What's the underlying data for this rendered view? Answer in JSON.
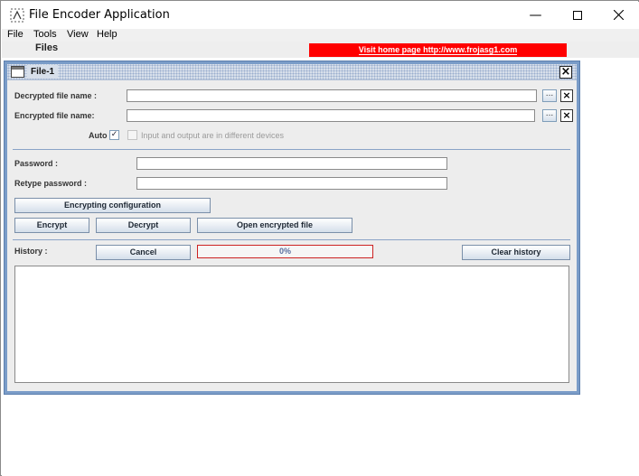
{
  "app": {
    "title": "File Encoder Application"
  },
  "menu": [
    "File",
    "Tools",
    "View",
    "Help"
  ],
  "toolbar": {
    "files_label": "Files",
    "home_link": "Visit home page http://www.frojasg1.com"
  },
  "frame": {
    "title": "File-1"
  },
  "form": {
    "decrypted_label": "Decrypted file name :",
    "encrypted_label": "Encrypted file name:",
    "decrypted_value": "",
    "encrypted_value": "",
    "browse_label": "...",
    "clear_label": "×",
    "auto_label": "Auto",
    "auto_checked_mark": "✓",
    "different_devices_label": "Input and output are in different devices",
    "password_label": "Password :",
    "retype_label": "Retype password :",
    "password_value": "",
    "retype_value": ""
  },
  "buttons": {
    "encrypting_config": "Encrypting configuration",
    "encrypt": "Encrypt",
    "decrypt": "Decrypt",
    "open_encrypted": "Open encrypted file",
    "cancel": "Cancel",
    "clear_history": "Clear history"
  },
  "history": {
    "label": "History :",
    "progress_text": "0%",
    "progress": 0
  },
  "colors": {
    "link_bg": "#ff0000",
    "frame_border": "#7a9cc8",
    "progress_border": "#cc2222"
  }
}
